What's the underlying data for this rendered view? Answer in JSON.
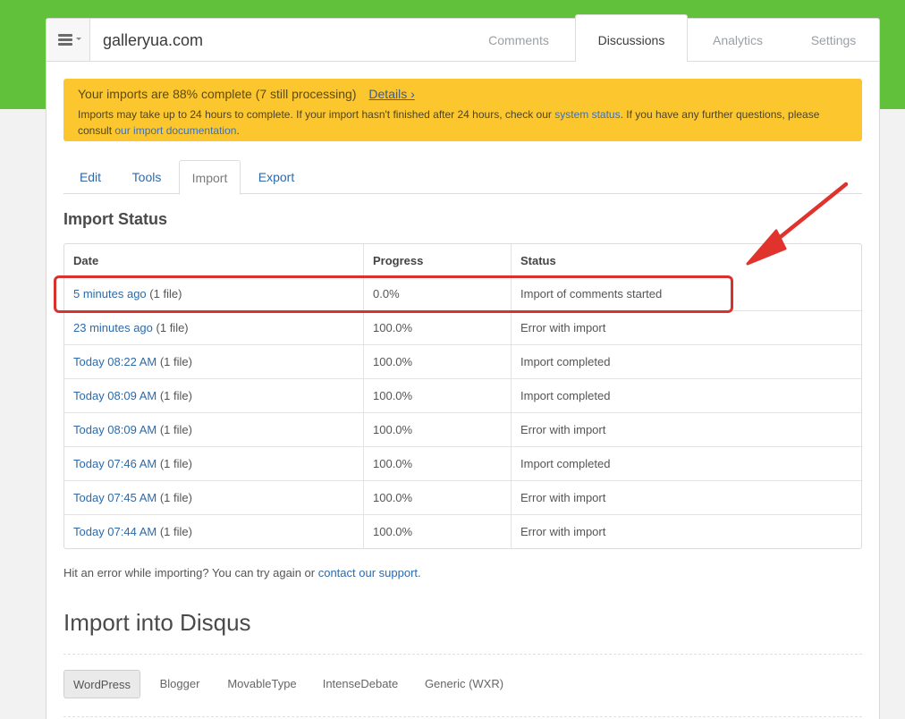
{
  "header": {
    "site_name": "galleryua.com",
    "menu_icon": "hamburger-icon",
    "tabs": [
      "Comments",
      "Discussions",
      "Analytics",
      "Settings"
    ],
    "active_tab": "Discussions"
  },
  "alert": {
    "headline": "Your imports are 88% complete (7 still processing)",
    "details_link": "Details ›",
    "body_1": "Imports may take up to 24 hours to complete. If your import hasn't finished after 24 hours, check our ",
    "system_status_link": "system status",
    "body_2": ". If you have any further questions, please consult ",
    "documentation_link": "our import documentation",
    "body_3": ".",
    "background_color": "#fcc72e"
  },
  "subtabs": [
    "Edit",
    "Tools",
    "Import",
    "Export"
  ],
  "active_subtab": "Import",
  "import_status": {
    "title": "Import Status",
    "columns": [
      "Date",
      "Progress",
      "Status"
    ],
    "rows": [
      {
        "date": "5 minutes ago",
        "files": " (1 file)",
        "progress": "0.0%",
        "status": "Import of comments started"
      },
      {
        "date": "23 minutes ago",
        "files": " (1 file)",
        "progress": "100.0%",
        "status": "Error with import"
      },
      {
        "date": "Today 08:22 AM",
        "files": " (1 file)",
        "progress": "100.0%",
        "status": "Import completed"
      },
      {
        "date": "Today 08:09 AM",
        "files": " (1 file)",
        "progress": "100.0%",
        "status": "Import completed"
      },
      {
        "date": "Today 08:09 AM",
        "files": " (1 file)",
        "progress": "100.0%",
        "status": "Error with import"
      },
      {
        "date": "Today 07:46 AM",
        "files": " (1 file)",
        "progress": "100.0%",
        "status": "Import completed"
      },
      {
        "date": "Today 07:45 AM",
        "files": " (1 file)",
        "progress": "100.0%",
        "status": "Error with import"
      },
      {
        "date": "Today 07:44 AM",
        "files": " (1 file)",
        "progress": "100.0%",
        "status": "Error with import"
      }
    ]
  },
  "help": {
    "text": "Hit an error while importing? You can try again or ",
    "link": "contact our support",
    "suffix": "."
  },
  "import_into": {
    "title": "Import into Disqus",
    "platforms": [
      "WordPress",
      "Blogger",
      "MovableType",
      "IntenseDebate",
      "Generic (WXR)"
    ],
    "active_platform": "WordPress"
  },
  "colors": {
    "brand_green": "#62c13a",
    "link_blue": "#2e6aa8",
    "annotation_red": "#d9322d"
  }
}
